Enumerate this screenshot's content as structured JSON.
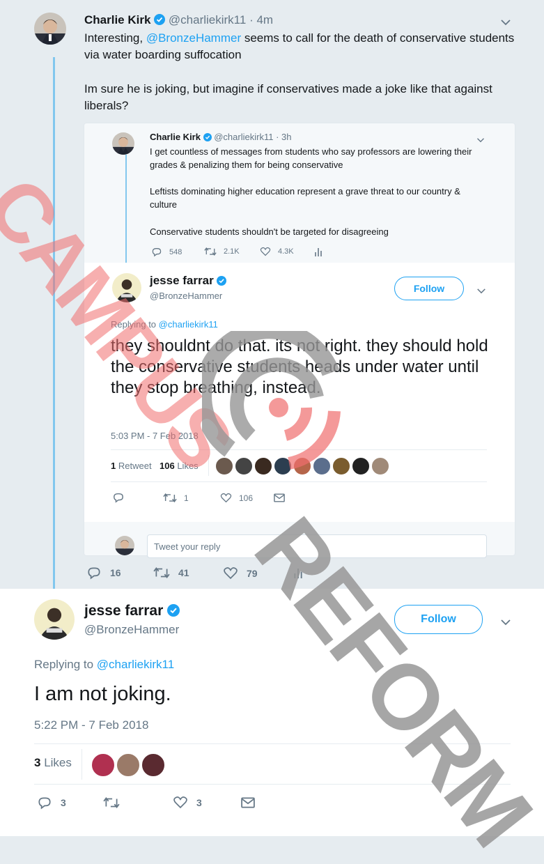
{
  "colors": {
    "accent": "#1da1f2",
    "text": "#14171a",
    "muted": "#657786",
    "watermark_red": "#f08a8a",
    "watermark_grey": "#9a9a9a"
  },
  "main_tweet": {
    "name": "Charlie Kirk",
    "handle": "@charliekirk11",
    "time": "· 4m",
    "text_pre": "Interesting, ",
    "mention": "@BronzeHammer",
    "text_post": " seems to call for the death of conservative students via water boarding suffocation",
    "text_p2": "Im sure he is joking, but imagine if conservatives made a joke like that against liberals?",
    "replies": "16",
    "retweets": "41",
    "likes": "79"
  },
  "quoted_parent": {
    "name": "Charlie Kirk",
    "handle": "@charliekirk11",
    "time": "· 3h",
    "p1": "I get countless of messages from students who say professors are lowering their grades & penalizing them for being conservative",
    "p2": "Leftists dominating higher education represent a grave threat to our country & culture",
    "p3": "Conservative students shouldn't be targeted for disagreeing",
    "replies": "548",
    "retweets": "2.1K",
    "likes": "4.3K"
  },
  "quoted_reply": {
    "name": "jesse farrar",
    "handle": "@BronzeHammer",
    "follow_label": "Follow",
    "replying_prefix": "Replying to ",
    "replying_to": "@charliekirk11",
    "text": "they shouldnt do that. its not right. they should hold the conservative students heads under water until they stop breathing, instead.",
    "timestamp": "5:03 PM - 7 Feb 2018",
    "retweet_count": "1",
    "retweet_label": "Retweet",
    "like_count": "106",
    "like_label": "Likes",
    "action_retweets": "1",
    "action_likes": "106",
    "reply_placeholder": "Tweet your reply"
  },
  "bottom_tweet": {
    "name": "jesse farrar",
    "handle": "@BronzeHammer",
    "follow_label": "Follow",
    "replying_prefix": "Replying to ",
    "replying_to": "@charliekirk11",
    "text": "I am not joking.",
    "timestamp": "5:22 PM - 7 Feb 2018",
    "like_count": "3",
    "like_label": "Likes",
    "action_replies": "3",
    "action_likes": "3"
  },
  "watermark": {
    "line1": "CAMPUS",
    "line2": "REFORM"
  },
  "icons": [
    "verified-icon",
    "caret-down-icon",
    "reply-icon",
    "retweet-icon",
    "like-icon",
    "analytics-icon",
    "message-icon"
  ]
}
